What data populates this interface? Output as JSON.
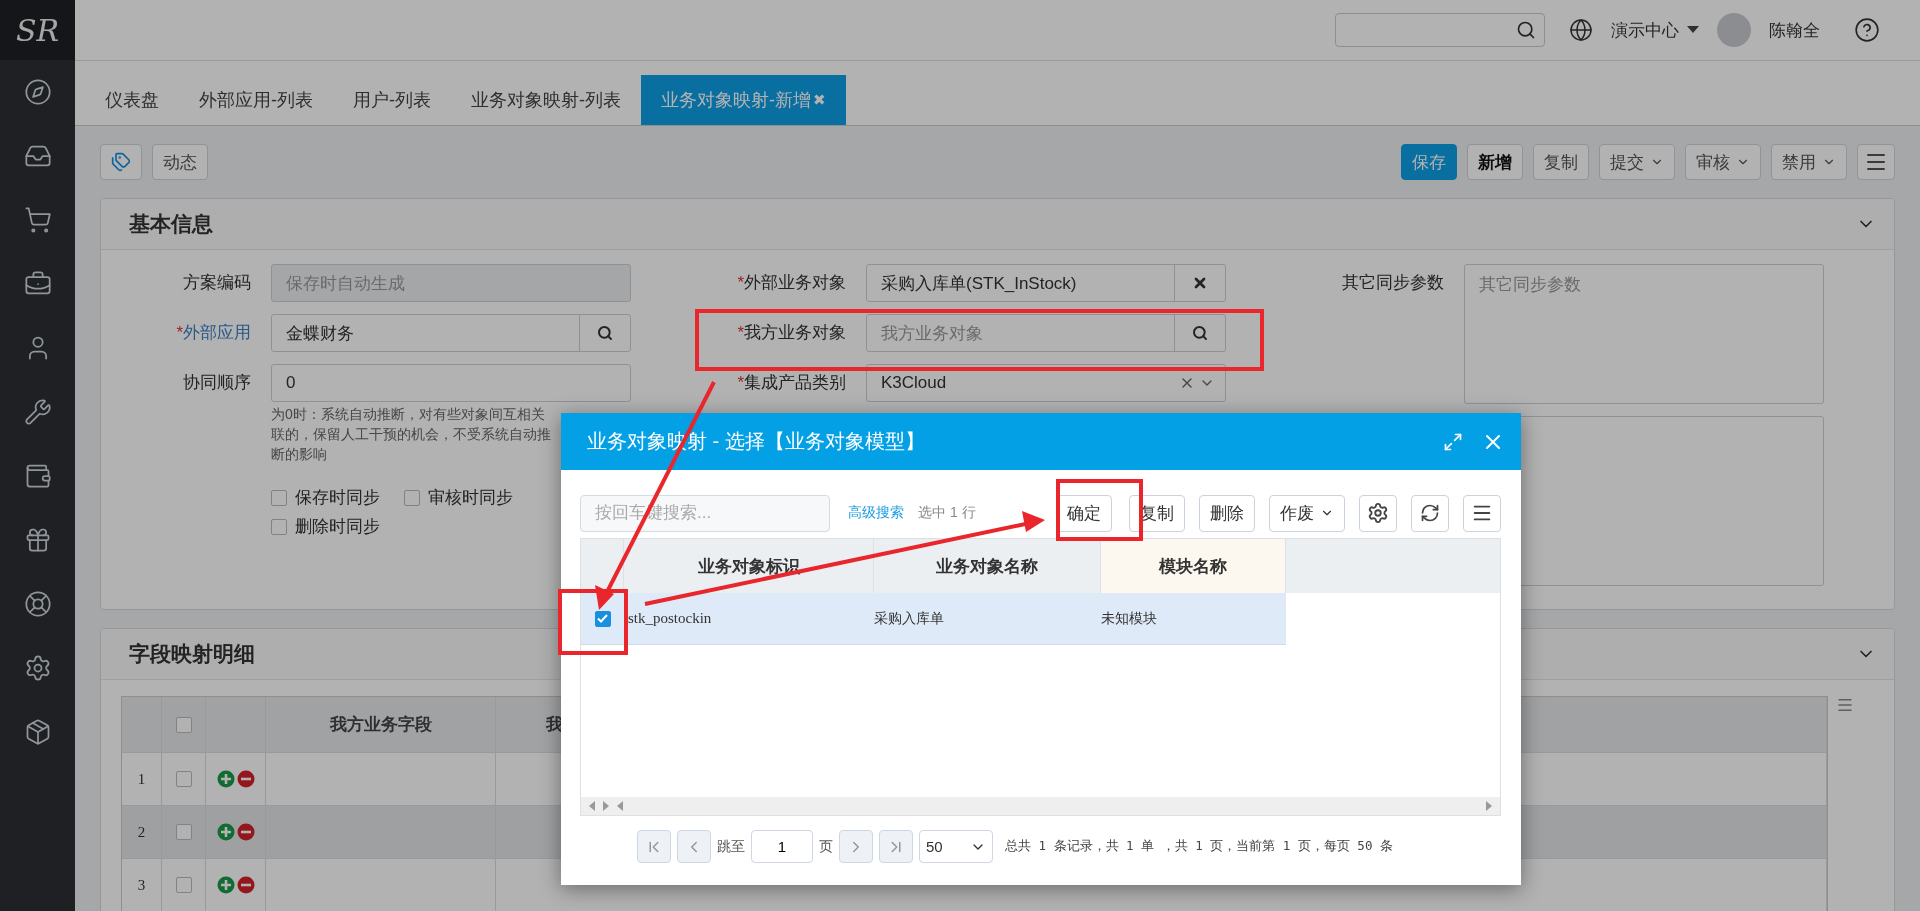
{
  "logo": "SR",
  "header": {
    "org": "演示中心",
    "user": "陈翰全"
  },
  "tabs": [
    {
      "label": "仪表盘",
      "selected": false
    },
    {
      "label": "外部应用-列表",
      "selected": false
    },
    {
      "label": "用户-列表",
      "selected": false
    },
    {
      "label": "业务对象映射-列表",
      "selected": false
    },
    {
      "label": "业务对象映射-新增",
      "selected": true,
      "close": "✖"
    }
  ],
  "toolbar": {
    "left": [
      "动态"
    ],
    "right": [
      {
        "label": "保存",
        "kind": "primary"
      },
      {
        "label": "新增",
        "kind": "emphasis"
      },
      {
        "label": "复制",
        "kind": "plain"
      },
      {
        "label": "提交",
        "kind": "dropdown"
      },
      {
        "label": "审核",
        "kind": "dropdown"
      },
      {
        "label": "禁用",
        "kind": "dropdown"
      }
    ]
  },
  "basic_info": {
    "title": "基本信息",
    "left_fields": [
      {
        "label": "方案编码",
        "link": false,
        "kind": "readonly",
        "placeholder": "保存时自动生成"
      },
      {
        "label": "外部应用",
        "mark": "*",
        "link": true,
        "kind": "lookup",
        "value": "金蝶财务"
      },
      {
        "label": "协同顺序",
        "link": false,
        "kind": "text",
        "value": "0",
        "hint": "为0时：系统自动推断，对有些对象间互相关联的，保留人工干预的机会，不受系统自动推断的影响"
      }
    ],
    "sync_options": [
      {
        "label": "保存时同步",
        "checked": false
      },
      {
        "label": "审核时同步",
        "checked": false
      },
      {
        "label": "删除时同步",
        "checked": false
      }
    ],
    "middle_fields": [
      {
        "label": "外部业务对象",
        "mark": "*",
        "link": false,
        "kind": "clearable",
        "value": "采购入库单(STK_InStock)"
      },
      {
        "label": "我方业务对象",
        "mark": "*",
        "link": false,
        "kind": "lookup",
        "placeholder": "我方业务对象"
      },
      {
        "label": "集成产品类别",
        "mark": "*",
        "link": false,
        "kind": "select",
        "value": "K3Cloud"
      }
    ],
    "right_fields": [
      {
        "label": "其它同步参数",
        "kind": "textarea",
        "placeholder": "其它同步参数"
      },
      {
        "kind": "textarea"
      }
    ]
  },
  "detail": {
    "title": "字段映射明细",
    "header_checked": false,
    "columns": [
      "我方业务字段",
      "我"
    ],
    "rows": [
      {
        "number": "1",
        "checked": false,
        "selected": false
      },
      {
        "number": "2",
        "checked": false,
        "selected": true
      },
      {
        "number": "3",
        "checked": false,
        "selected": false
      }
    ]
  },
  "dialog": {
    "title": "业务对象映射 - 选择【业务对象模型】",
    "search": {
      "placeholder": "按回车键搜索..."
    },
    "advanced_search": "高级搜索",
    "selection_count": "选中 1 行",
    "buttons": [
      {
        "label": "确定",
        "kind": "plain"
      },
      {
        "label": "复制",
        "kind": "plain"
      },
      {
        "label": "删除",
        "kind": "plain"
      },
      {
        "label": "作废",
        "kind": "dropdown"
      }
    ],
    "columns": [
      {
        "label": "业务对象标识",
        "highlighted": false
      },
      {
        "label": "业务对象名称",
        "highlighted": false
      },
      {
        "label": "模块名称",
        "highlighted": true
      }
    ],
    "rows": [
      {
        "checked": true,
        "selected": true,
        "cells": [
          "stk_postockin",
          "采购入库单",
          "未知模块"
        ]
      }
    ],
    "pagination": {
      "jump_label": "跳至",
      "page": "1",
      "page_unit": "页",
      "page_size": "50",
      "summary": "总共 1 条记录，共 1 单 ，共 1 页，当前第 1 页，每页 50 条"
    }
  }
}
